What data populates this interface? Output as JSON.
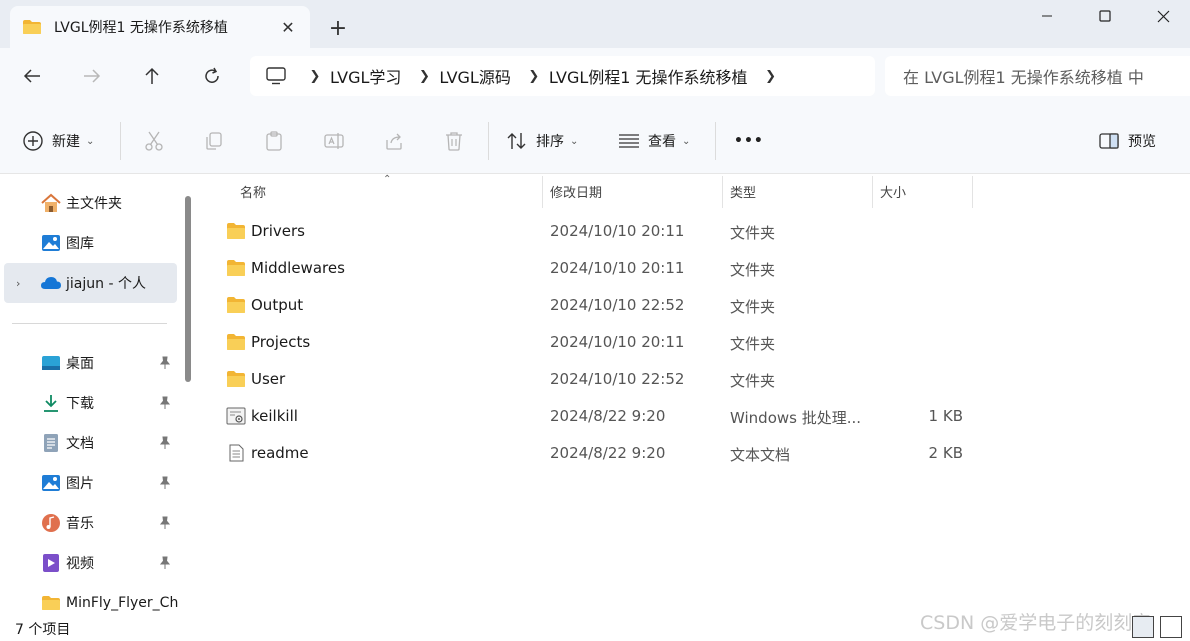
{
  "window": {
    "tab_title": "LVGL例程1 无操作系统移植",
    "tab_close": "✕",
    "new_tab": "+"
  },
  "address": {
    "crumbs": [
      "LVGL学习",
      "LVGL源码",
      "LVGL例程1 无操作系统移植"
    ],
    "search_placeholder": "在 LVGL例程1 无操作系统移植 中"
  },
  "toolbar": {
    "new_label": "新建",
    "sort_label": "排序",
    "view_label": "查看",
    "more_label": "•••",
    "preview_label": "预览"
  },
  "sidebar": {
    "items": [
      {
        "label": "主文件夹",
        "icon": "home-icon"
      },
      {
        "label": "图库",
        "icon": "gallery-icon"
      },
      {
        "label": "jiajun - 个人",
        "icon": "onedrive-cloud-icon"
      },
      {
        "label": "桌面",
        "icon": "desktop-icon"
      },
      {
        "label": "下载",
        "icon": "download-icon"
      },
      {
        "label": "文档",
        "icon": "document-icon"
      },
      {
        "label": "图片",
        "icon": "pictures-icon"
      },
      {
        "label": "音乐",
        "icon": "music-icon"
      },
      {
        "label": "视频",
        "icon": "video-icon"
      },
      {
        "label": "MinFly_Flyer_Ch",
        "icon": "folder-icon"
      }
    ]
  },
  "columns": {
    "name": "名称",
    "date": "修改日期",
    "type": "类型",
    "size": "大小"
  },
  "files": [
    {
      "name": "Drivers",
      "date": "2024/10/10 20:11",
      "type": "文件夹",
      "size": "",
      "icon": "folder-icon"
    },
    {
      "name": "Middlewares",
      "date": "2024/10/10 20:11",
      "type": "文件夹",
      "size": "",
      "icon": "folder-icon"
    },
    {
      "name": "Output",
      "date": "2024/10/10 22:52",
      "type": "文件夹",
      "size": "",
      "icon": "folder-icon"
    },
    {
      "name": "Projects",
      "date": "2024/10/10 20:11",
      "type": "文件夹",
      "size": "",
      "icon": "folder-icon"
    },
    {
      "name": "User",
      "date": "2024/10/10 22:52",
      "type": "文件夹",
      "size": "",
      "icon": "folder-icon"
    },
    {
      "name": "keilkill",
      "date": "2024/8/22 9:20",
      "type": "Windows 批处理...",
      "size": "1 KB",
      "icon": "batch-file-icon"
    },
    {
      "name": "readme",
      "date": "2024/8/22 9:20",
      "type": "文本文档",
      "size": "2 KB",
      "icon": "text-file-icon"
    }
  ],
  "status": {
    "item_count": "7 个项目",
    "watermark": "CSDN @爱学电子的刻刻帝"
  },
  "colors": {
    "accent": "#0067c0",
    "folder": "#f7c948",
    "chrome_bg": "#e9edf3",
    "toolbar_bg": "#f7f9fc"
  }
}
